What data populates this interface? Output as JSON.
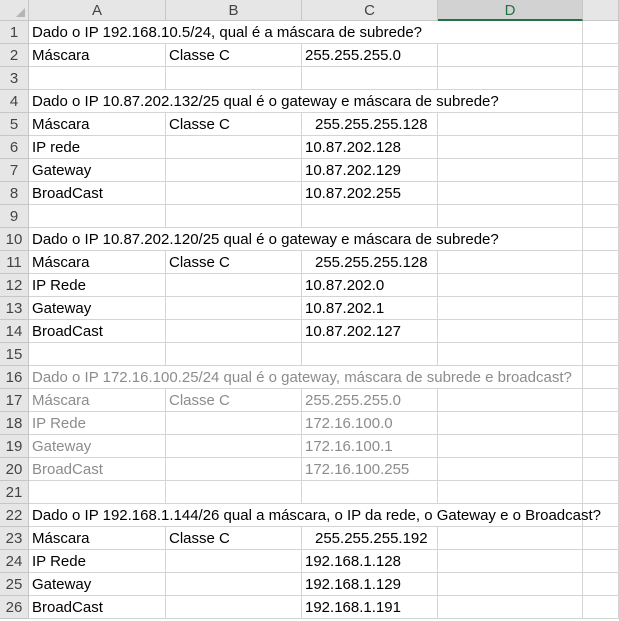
{
  "columns": [
    "A",
    "B",
    "C",
    "D"
  ],
  "rows": [
    {
      "n": "1",
      "a": "Dado o IP 192.168.10.5/24, qual é a máscara de subrede?",
      "b": "",
      "c": "",
      "long": true
    },
    {
      "n": "2",
      "a": "Máscara",
      "b": "Classe C",
      "c": "255.255.255.0"
    },
    {
      "n": "3",
      "a": "",
      "b": "",
      "c": ""
    },
    {
      "n": "4",
      "a": "Dado o IP 10.87.202.132/25 qual é o gateway e máscara de subrede?",
      "b": "",
      "c": "",
      "long": true
    },
    {
      "n": "5",
      "a": "Máscara",
      "b": "Classe C",
      "c": "255.255.255.128",
      "indent": true
    },
    {
      "n": "6",
      "a": "IP rede",
      "b": "",
      "c": "10.87.202.128"
    },
    {
      "n": "7",
      "a": "Gateway",
      "b": "",
      "c": "10.87.202.129"
    },
    {
      "n": "8",
      "a": "BroadCast",
      "b": "",
      "c": "10.87.202.255"
    },
    {
      "n": "9",
      "a": "",
      "b": "",
      "c": ""
    },
    {
      "n": "10",
      "a": "Dado o IP 10.87.202.120/25 qual é o gateway e máscara de subrede?",
      "b": "",
      "c": "",
      "long": true
    },
    {
      "n": "11",
      "a": "Máscara",
      "b": "Classe C",
      "c": "255.255.255.128",
      "indent": true
    },
    {
      "n": "12",
      "a": "IP Rede",
      "b": "",
      "c": "10.87.202.0"
    },
    {
      "n": "13",
      "a": "Gateway",
      "b": "",
      "c": "10.87.202.1"
    },
    {
      "n": "14",
      "a": "BroadCast",
      "b": "",
      "c": "10.87.202.127"
    },
    {
      "n": "15",
      "a": "",
      "b": "",
      "c": ""
    },
    {
      "n": "16",
      "a": "Dado o IP 172.16.100.25/24 qual é o gateway, máscara de subrede e broadcast?",
      "b": "",
      "c": "",
      "long": true,
      "grey": true
    },
    {
      "n": "17",
      "a": "Máscara",
      "b": "Classe C",
      "c": "255.255.255.0",
      "grey": true
    },
    {
      "n": "18",
      "a": "IP Rede",
      "b": "",
      "c": "172.16.100.0",
      "grey": true
    },
    {
      "n": "19",
      "a": "Gateway",
      "b": "",
      "c": "172.16.100.1",
      "grey": true
    },
    {
      "n": "20",
      "a": "BroadCast",
      "b": "",
      "c": "172.16.100.255",
      "grey": true
    },
    {
      "n": "21",
      "a": "",
      "b": "",
      "c": ""
    },
    {
      "n": "22",
      "a": "Dado o IP 192.168.1.144/26 qual a máscara, o IP da rede, o Gateway e o Broadcast?",
      "b": "",
      "c": "",
      "long": true
    },
    {
      "n": "23",
      "a": "Máscara",
      "b": "Classe C",
      "c": "255.255.255.192",
      "indent": true
    },
    {
      "n": "24",
      "a": "IP Rede",
      "b": "",
      "c": "192.168.1.128"
    },
    {
      "n": "25",
      "a": "Gateway",
      "b": "",
      "c": "192.168.1.129"
    },
    {
      "n": "26",
      "a": "BroadCast",
      "b": "",
      "c": "192.168.1.191"
    }
  ]
}
